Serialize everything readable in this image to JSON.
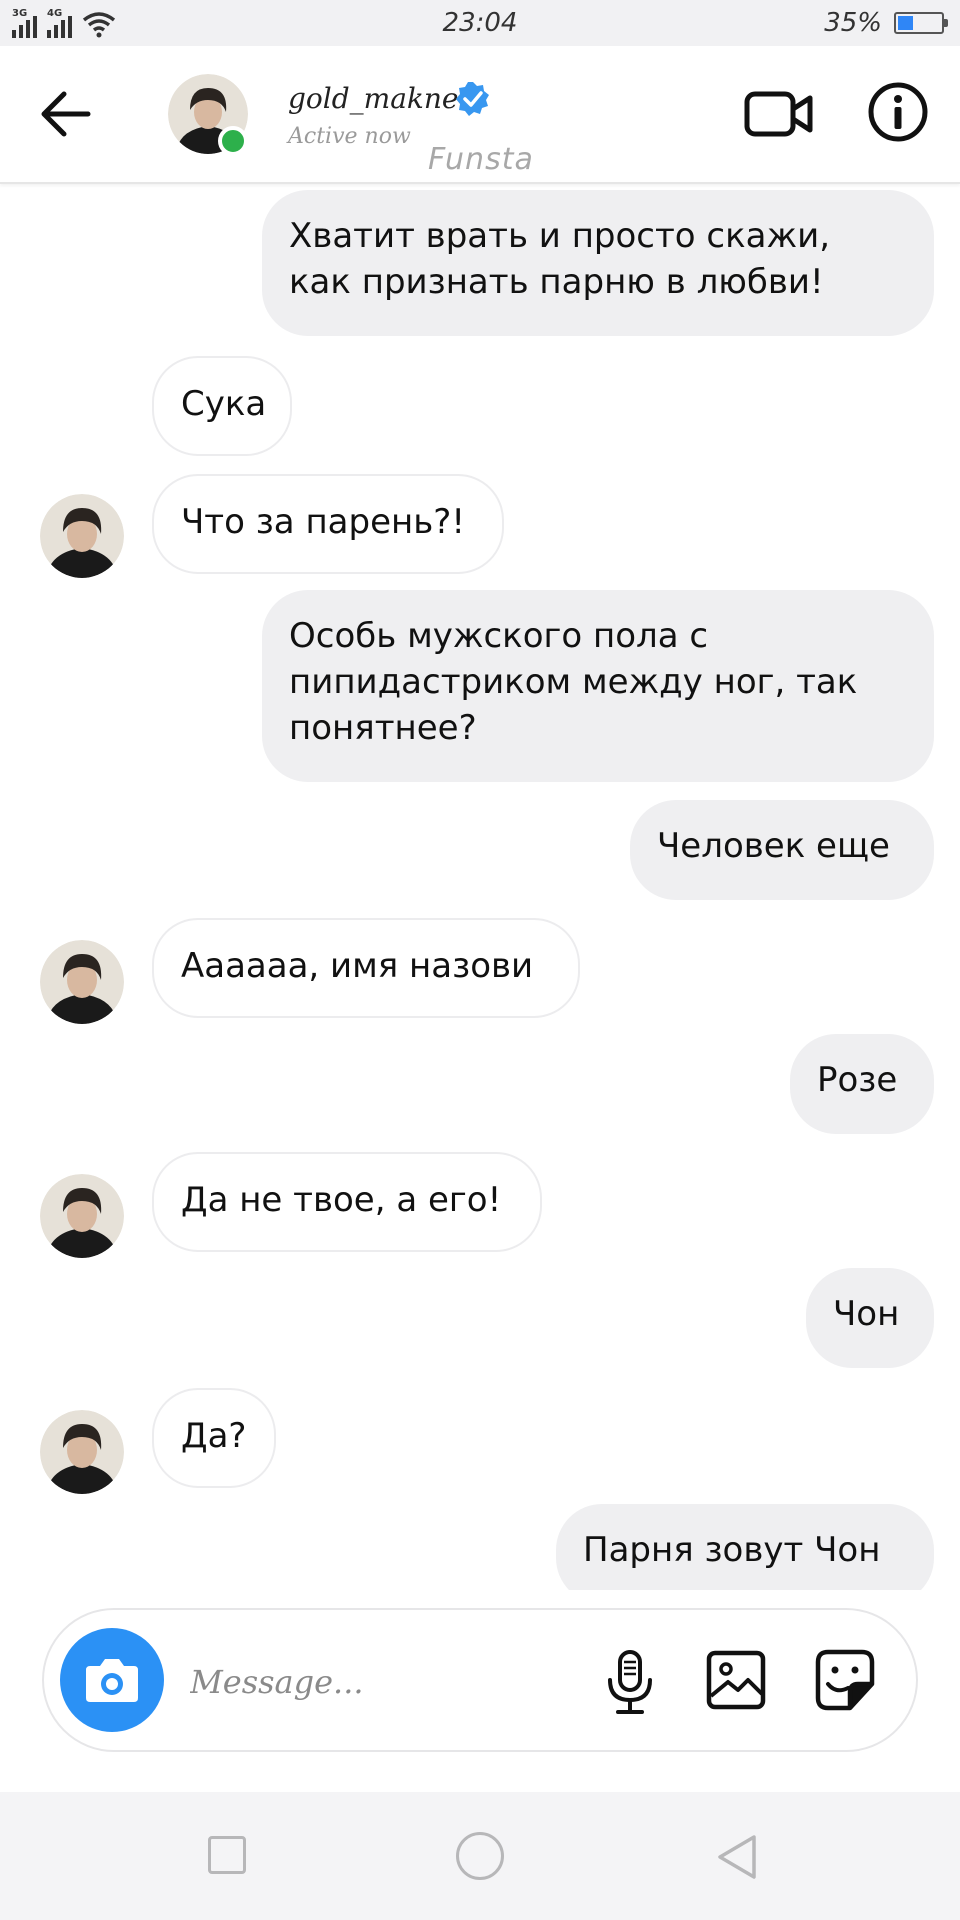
{
  "status_bar": {
    "network_1": "3G",
    "network_2": "4G",
    "time": "23:04",
    "battery_percent": "35%",
    "battery_level": 0.35
  },
  "header": {
    "username": "gold_makne",
    "status": "Active now",
    "watermark": "Funsta",
    "verified": true,
    "online_color": "#2db04b",
    "verified_color": "#3897f0"
  },
  "messages": [
    {
      "side": "sent",
      "text": "Хватит врать и просто скажи,\nкак признать парню в любви!"
    },
    {
      "side": "recv",
      "text": "Сука",
      "avatar": false
    },
    {
      "side": "recv",
      "text": "Что за парень?!",
      "avatar": true
    },
    {
      "side": "sent",
      "text": "Особь мужского пола с\nпипидастриком между ног, так\nпонятнее?"
    },
    {
      "side": "sent",
      "text": "Человек еще"
    },
    {
      "side": "recv",
      "text": "Аааааа, имя назови",
      "avatar": true
    },
    {
      "side": "sent",
      "text": "Розе"
    },
    {
      "side": "recv",
      "text": "Да не твое, а его!",
      "avatar": true
    },
    {
      "side": "sent",
      "text": "Чон"
    },
    {
      "side": "recv",
      "text": "Да?",
      "avatar": true
    },
    {
      "side": "sent",
      "text": "Парня зовут Чон"
    }
  ],
  "composer": {
    "placeholder": "Message...",
    "camera_color": "#2b91f5"
  },
  "icons": {
    "back": "arrow-left-icon",
    "video": "video-camera-icon",
    "info": "info-icon",
    "camera": "camera-icon",
    "mic": "microphone-icon",
    "gallery": "image-icon",
    "sticker": "sticker-icon"
  }
}
